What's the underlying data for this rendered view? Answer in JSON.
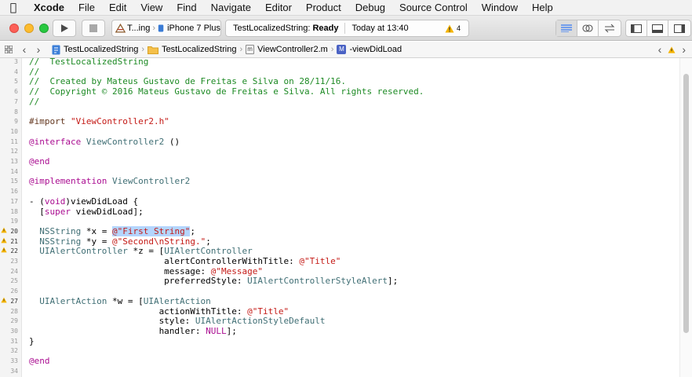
{
  "menubar": {
    "app": "Xcode",
    "items": [
      "File",
      "Edit",
      "View",
      "Find",
      "Navigate",
      "Editor",
      "Product",
      "Debug",
      "Source Control",
      "Window",
      "Help"
    ]
  },
  "toolbar": {
    "scheme": "T...ing",
    "device": "iPhone 7 Plus",
    "status_project": "TestLocalizedString:",
    "status_state": "Ready",
    "status_time": "Today at 13:40",
    "warning_count": "4"
  },
  "jumpbar": {
    "crumbs": [
      "TestLocalizedString",
      "TestLocalizedString",
      "ViewController2.m",
      "-viewDidLoad"
    ],
    "file_badge": "m",
    "method_badge": "M"
  },
  "code": {
    "lines": [
      {
        "num": "3",
        "text": "//  TestLocalizedString",
        "style": "cm"
      },
      {
        "num": "4",
        "text": "//",
        "style": "cm"
      },
      {
        "num": "5",
        "text": "//  Created by Mateus Gustavo de Freitas e Silva on 28/11/16.",
        "style": "cm"
      },
      {
        "num": "6",
        "text": "//  Copyright © 2016 Mateus Gustavo de Freitas e Silva. All rights reserved.",
        "style": "cm"
      },
      {
        "num": "7",
        "text": "//",
        "style": "cm"
      },
      {
        "num": "8",
        "text": "",
        "style": ""
      },
      {
        "num": "9",
        "text": "#import \"ViewController2.h\"",
        "style": "dir"
      },
      {
        "num": "10",
        "text": "",
        "style": ""
      },
      {
        "num": "11",
        "text": "@interface ViewController2 ()",
        "style": "iface"
      },
      {
        "num": "12",
        "text": "",
        "style": ""
      },
      {
        "num": "13",
        "text": "@end",
        "style": "kw"
      },
      {
        "num": "14",
        "text": "",
        "style": ""
      },
      {
        "num": "15",
        "text": "@implementation ViewController2",
        "style": "impl"
      },
      {
        "num": "16",
        "text": "",
        "style": ""
      },
      {
        "num": "17",
        "text": "- (void)viewDidLoad {",
        "style": "method"
      },
      {
        "num": "18",
        "text": "  [super viewDidLoad];",
        "style": "super"
      },
      {
        "num": "19",
        "text": "",
        "style": ""
      },
      {
        "num": "20",
        "text": "  NSString *x = @\"First String\";",
        "style": "strvar",
        "warn": true
      },
      {
        "num": "21",
        "text": "  NSString *y = @\"Second\\nString.\";",
        "style": "strvar",
        "warn": true
      },
      {
        "num": "22",
        "text": "  UIAlertController *z = [UIAlertController",
        "style": "alert",
        "warn": true
      },
      {
        "num": "23",
        "text": "                          alertControllerWithTitle: @\"Title\"",
        "style": "arg"
      },
      {
        "num": "24",
        "text": "                          message: @\"Message\"",
        "style": "arg"
      },
      {
        "num": "25",
        "text": "                          preferredStyle: UIAlertControllerStyleAlert];",
        "style": "plain"
      },
      {
        "num": "26",
        "text": "",
        "style": ""
      },
      {
        "num": "27",
        "text": "  UIAlertAction *w = [UIAlertAction",
        "style": "alert",
        "warn": true
      },
      {
        "num": "28",
        "text": "                         actionWithTitle: @\"Title\"",
        "style": "arg"
      },
      {
        "num": "29",
        "text": "                         style: UIAlertActionStyleDefault",
        "style": "plain"
      },
      {
        "num": "30",
        "text": "                         handler: NULL];",
        "style": "null"
      },
      {
        "num": "31",
        "text": "}",
        "style": "plain"
      },
      {
        "num": "32",
        "text": "",
        "style": ""
      },
      {
        "num": "33",
        "text": "@end",
        "style": "kw"
      },
      {
        "num": "34",
        "text": "",
        "style": ""
      }
    ]
  }
}
